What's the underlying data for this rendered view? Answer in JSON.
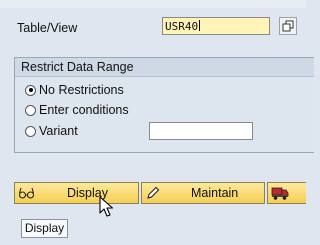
{
  "selection": {
    "table_label": "Table/View",
    "table_value": "USR40"
  },
  "restrict_group": {
    "title": "Restrict Data Range",
    "options": [
      {
        "label": "No Restrictions",
        "selected": true
      },
      {
        "label": "Enter conditions",
        "selected": false
      },
      {
        "label": "Variant",
        "selected": false
      }
    ],
    "variant_value": ""
  },
  "toolbar": {
    "display_label": "Display",
    "maintain_label": "Maintain"
  },
  "footer": {
    "display_label": "Display"
  }
}
